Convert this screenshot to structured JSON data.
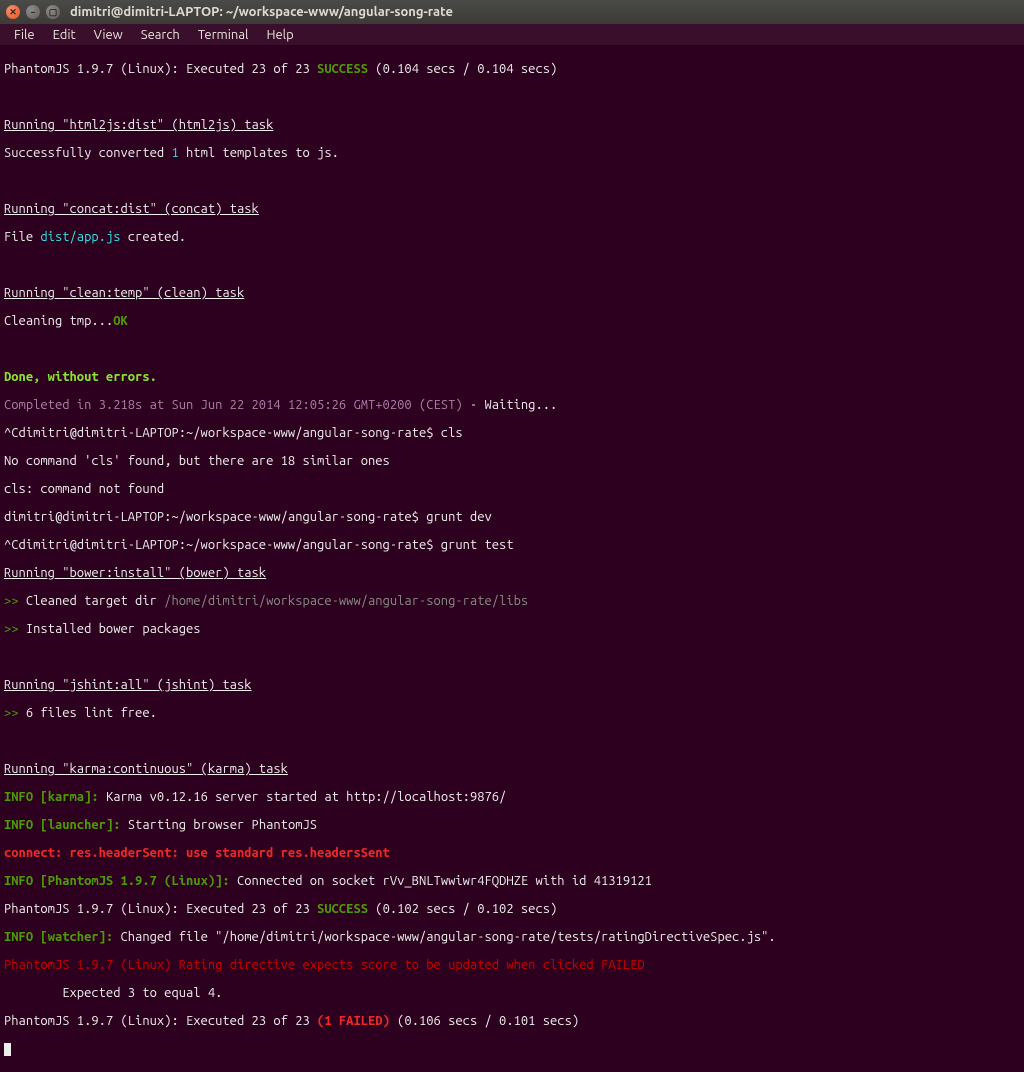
{
  "window": {
    "title": "dimitri@dimitri-LAPTOP: ~/workspace-www/angular-song-rate"
  },
  "menubar": {
    "items": [
      "File",
      "Edit",
      "View",
      "Search",
      "Terminal",
      "Help"
    ]
  },
  "lines": {
    "l01a": "PhantomJS 1.9.7 (Linux): Executed 23 of 23 ",
    "l01b": "SUCCESS",
    "l01c": " (0.104 secs / 0.104 secs)",
    "l03a": "Running \"html2js:dist\" (html2js) task",
    "l04a": "Successfully converted ",
    "l04b": "1",
    "l04c": " html templates to js.",
    "l06a": "Running \"concat:dist\" (concat) task",
    "l07a": "File ",
    "l07b": "dist/app.js",
    "l07c": " created.",
    "l09a": "Running \"clean:temp\" (clean) task",
    "l10a": "Cleaning tmp...",
    "l10b": "OK",
    "l12a": "Done, without errors.",
    "l13a": "Completed in 3.218s at Sun Jun 22 2014 12:05:26 GMT+0200 (CEST)",
    "l13b": " - Waiting...",
    "l14a": "^Cdimitri@dimitri-LAPTOP:~/workspace-www/angular-song-rate$ cls",
    "l15a": "No command 'cls' found, but there are 18 similar ones",
    "l16a": "cls: command not found",
    "l17a": "dimitri@dimitri-LAPTOP:~/workspace-www/angular-song-rate$ grunt dev",
    "l18a": "^Cdimitri@dimitri-LAPTOP:~/workspace-www/angular-song-rate$ grunt test",
    "l19a": "Running \"bower:install\" (bower) task",
    "l20a": ">> ",
    "l20b": "Cleaned target dir ",
    "l20c": "/home/dimitri/workspace-www/angular-song-rate/libs",
    "l21a": ">> ",
    "l21b": "Installed bower packages",
    "l23a": "Running \"jshint:all\" (jshint) task",
    "l24a": ">> ",
    "l24b": "6 files lint free.",
    "l26a": "Running \"karma:continuous\" (karma) task",
    "l27a": "INFO [",
    "l27b": "karma",
    "l27c": "]: ",
    "l27d": "Karma v0.12.16 server started at http://localhost:9876/",
    "l28a": "INFO [",
    "l28b": "launcher",
    "l28c": "]: ",
    "l28d": "Starting browser PhantomJS",
    "l29a": "connect: res.headerSent: use standard res.headersSent",
    "l30a": "INFO [",
    "l30b": "PhantomJS 1.9.7 (Linux)",
    "l30c": "]: ",
    "l30d": "Connected on socket rVv_BNLTwwiwr4FQDHZE with id 41319121",
    "l31a": "PhantomJS 1.9.7 (Linux): Executed 23 of 23 ",
    "l31b": "SUCCESS",
    "l31c": " (0.102 secs / 0.102 secs)",
    "l32a": "INFO [",
    "l32b": "watcher",
    "l32c": "]: ",
    "l32d": "Changed file \"/home/dimitri/workspace-www/angular-song-rate/tests/ratingDirectiveSpec.js\".",
    "l33a": "PhantomJS 1.9.7 (Linux) Rating directive expects score to be updated when clicked FAILED",
    "l34a": "        Expected 3 to equal 4.",
    "l35a": "PhantomJS 1.9.7 (Linux): Executed 23 of 23 ",
    "l35b": "(1 FAILED)",
    "l35c": " (0.106 secs / 0.101 secs)"
  }
}
